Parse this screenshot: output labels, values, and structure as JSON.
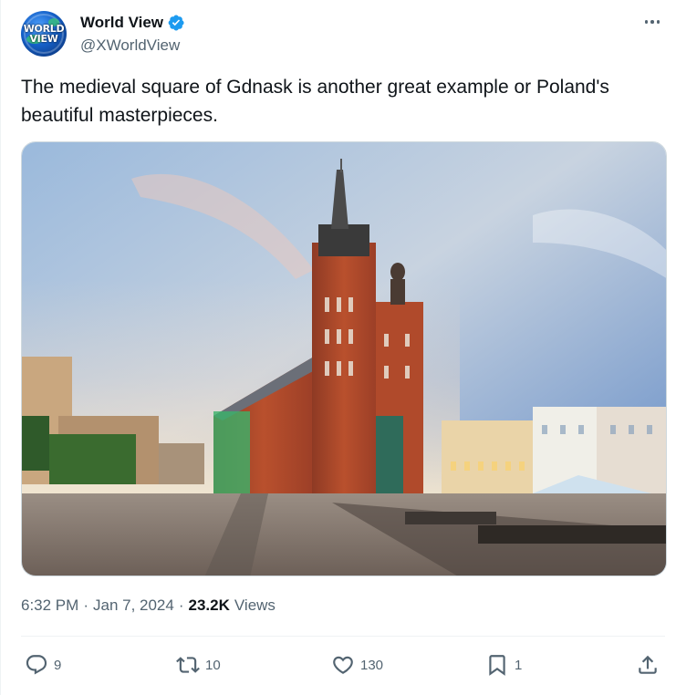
{
  "author": {
    "display_name": "World View",
    "handle": "@XWorldView",
    "avatar_text_line1": "WORLD",
    "avatar_text_line2": "VIEW",
    "verified": true
  },
  "tweet": {
    "text": "The medieval square of Gdnask is another great example or Poland's beautiful masterpieces."
  },
  "meta": {
    "time": "6:32 PM",
    "date": "Jan 7, 2024",
    "separator": "·",
    "views_count": "23.2K",
    "views_label": "Views"
  },
  "actions": {
    "replies": "9",
    "reposts": "10",
    "likes": "130",
    "bookmarks": "1"
  },
  "icons": {
    "verified": "verified-badge-icon",
    "more": "more-icon",
    "reply": "reply-icon",
    "repost": "repost-icon",
    "like": "heart-icon",
    "bookmark": "bookmark-icon",
    "share": "share-icon"
  },
  "colors": {
    "text_primary": "#0f1419",
    "text_secondary": "#536471",
    "verified_blue": "#1d9bf0",
    "divider": "#eff3f4"
  }
}
